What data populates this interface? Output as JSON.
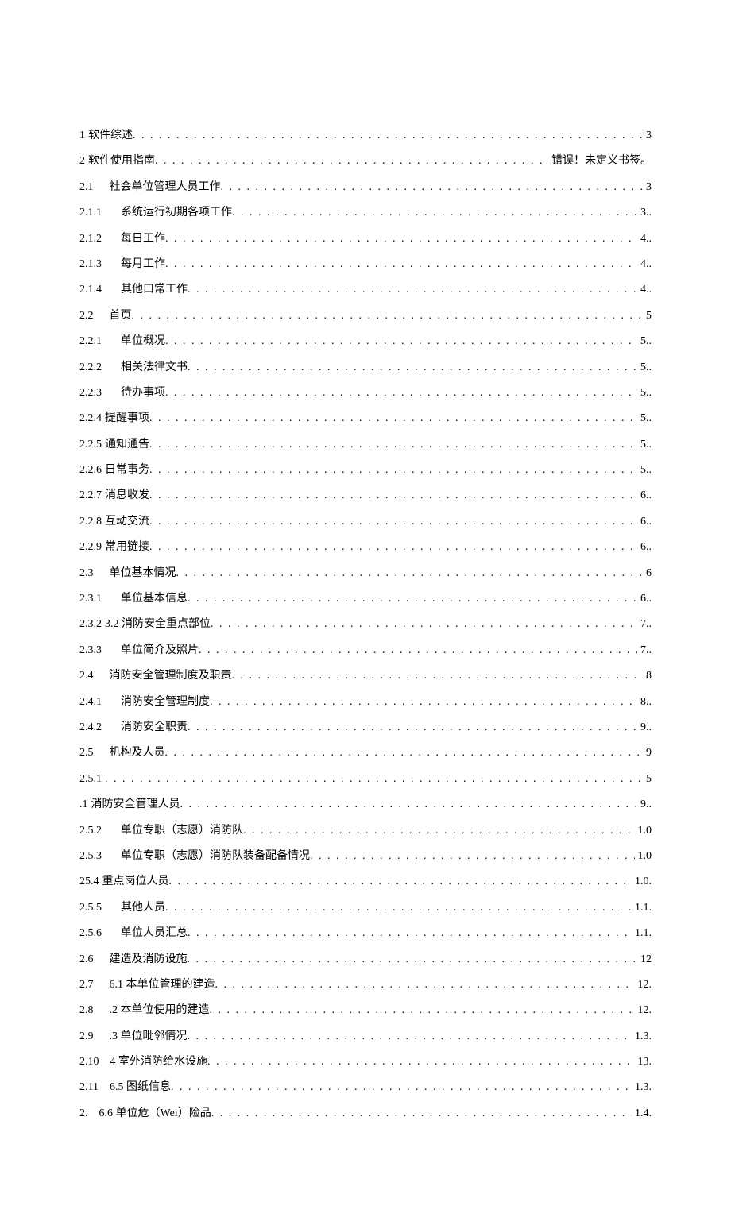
{
  "toc": [
    {
      "num": "1",
      "indent": 0,
      "title": "软件综述",
      "page": "3"
    },
    {
      "num": "2",
      "indent": 0,
      "title": "软件使用指南",
      "page": "错误！未定义书签。"
    },
    {
      "num": "2.1",
      "indent": 16,
      "title": "社会单位管理人员工作",
      "page": "3"
    },
    {
      "num": "2.1.1",
      "indent": 20,
      "title": "系统运行初期各项工作",
      "page": "3.."
    },
    {
      "num": "2.1.2",
      "indent": 20,
      "title": "每日工作",
      "page": "4.."
    },
    {
      "num": "2.1.3",
      "indent": 20,
      "title": "每月工作",
      "page": "4.."
    },
    {
      "num": "2.1.4",
      "indent": 20,
      "title": "其他口常工作",
      "page": "4.."
    },
    {
      "num": "2.2",
      "indent": 16,
      "title": "首页",
      "page": "5"
    },
    {
      "num": "2.2.1",
      "indent": 20,
      "title": "单位概况",
      "page": "5.."
    },
    {
      "num": "2.2.2",
      "indent": 20,
      "title": "相关法律文书",
      "page": "5.."
    },
    {
      "num": "2.2.3",
      "indent": 20,
      "title": "待办事项",
      "page": "5.."
    },
    {
      "num": "2.2.4",
      "indent": 0,
      "title": "提醒事项",
      "page": "5.."
    },
    {
      "num": "2.2.5",
      "indent": 0,
      "title": "通知通告",
      "page": "5.."
    },
    {
      "num": "2.2.6",
      "indent": 0,
      "title": "日常事务",
      "page": "5.."
    },
    {
      "num": "2.2.7",
      "indent": 0,
      "title": "消息收发",
      "page": "6.."
    },
    {
      "num": "2.2.8",
      "indent": 0,
      "title": "互动交流",
      "page": "6.."
    },
    {
      "num": "2.2.9",
      "indent": 0,
      "title": "常用链接",
      "page": "6.."
    },
    {
      "num": "2.3",
      "indent": 16,
      "title": "单位基本情况",
      "page": "6"
    },
    {
      "num": "2.3.1",
      "indent": 20,
      "title": "单位基本信息",
      "page": "6.."
    },
    {
      "num": "2.3.2",
      "indent": 0,
      "title": "3.2 消防安全重点部位",
      "page": "7.."
    },
    {
      "num": "2.3.3",
      "indent": 20,
      "title": "单位简介及照片",
      "page": "7.."
    },
    {
      "num": "2.4",
      "indent": 16,
      "title": "消防安全管理制度及职责",
      "page": "8"
    },
    {
      "num": "2.4.1",
      "indent": 20,
      "title": "消防安全管理制度",
      "page": "8.."
    },
    {
      "num": "2.4.2",
      "indent": 20,
      "title": "消防安全职责",
      "page": "9.."
    },
    {
      "num": "2.5",
      "indent": 16,
      "title": "机构及人员",
      "page": "9"
    },
    {
      "num": "2.5.1",
      "indent": 0,
      "title": "",
      "page": "5"
    },
    {
      "num": ".1",
      "indent": 0,
      "title": "消防安全管理人员",
      "page": "9.."
    },
    {
      "num": "2.5.2",
      "indent": 20,
      "title": "单位专职（志愿）消防队",
      "page": "1.0"
    },
    {
      "num": "2.5.3",
      "indent": 20,
      "title": "单位专职（志愿）消防队装备配备情况",
      "page": "1.0"
    },
    {
      "num": "25.4",
      "indent": 0,
      "title": "重点岗位人员",
      "page": "1.0."
    },
    {
      "num": "2.5.5",
      "indent": 20,
      "title": "其他人员",
      "page": "1.1."
    },
    {
      "num": "2.5.6",
      "indent": 20,
      "title": "单位人员汇总",
      "page": "1.1."
    },
    {
      "num": "2.6",
      "indent": 16,
      "title": "建造及消防设施",
      "page": "12"
    },
    {
      "num": "2.7",
      "indent": 16,
      "title": "6.1 本单位管理的建造",
      "page": "12."
    },
    {
      "num": "2.8",
      "indent": 16,
      "title": ".2 本单位使用的建造",
      "page": "12."
    },
    {
      "num": "2.9",
      "indent": 16,
      "title": ".3 单位毗邻情况",
      "page": "1.3."
    },
    {
      "num": "2.10",
      "indent": 10,
      "title": "4 室外消防给水设施",
      "page": "13."
    },
    {
      "num": "2.11",
      "indent": 10,
      "title": "6.5 图纸信息",
      "page": "1.3."
    },
    {
      "num": "2.",
      "indent": 10,
      "title": "6.6 单位危（Wei）险品",
      "page": "1.4."
    }
  ]
}
